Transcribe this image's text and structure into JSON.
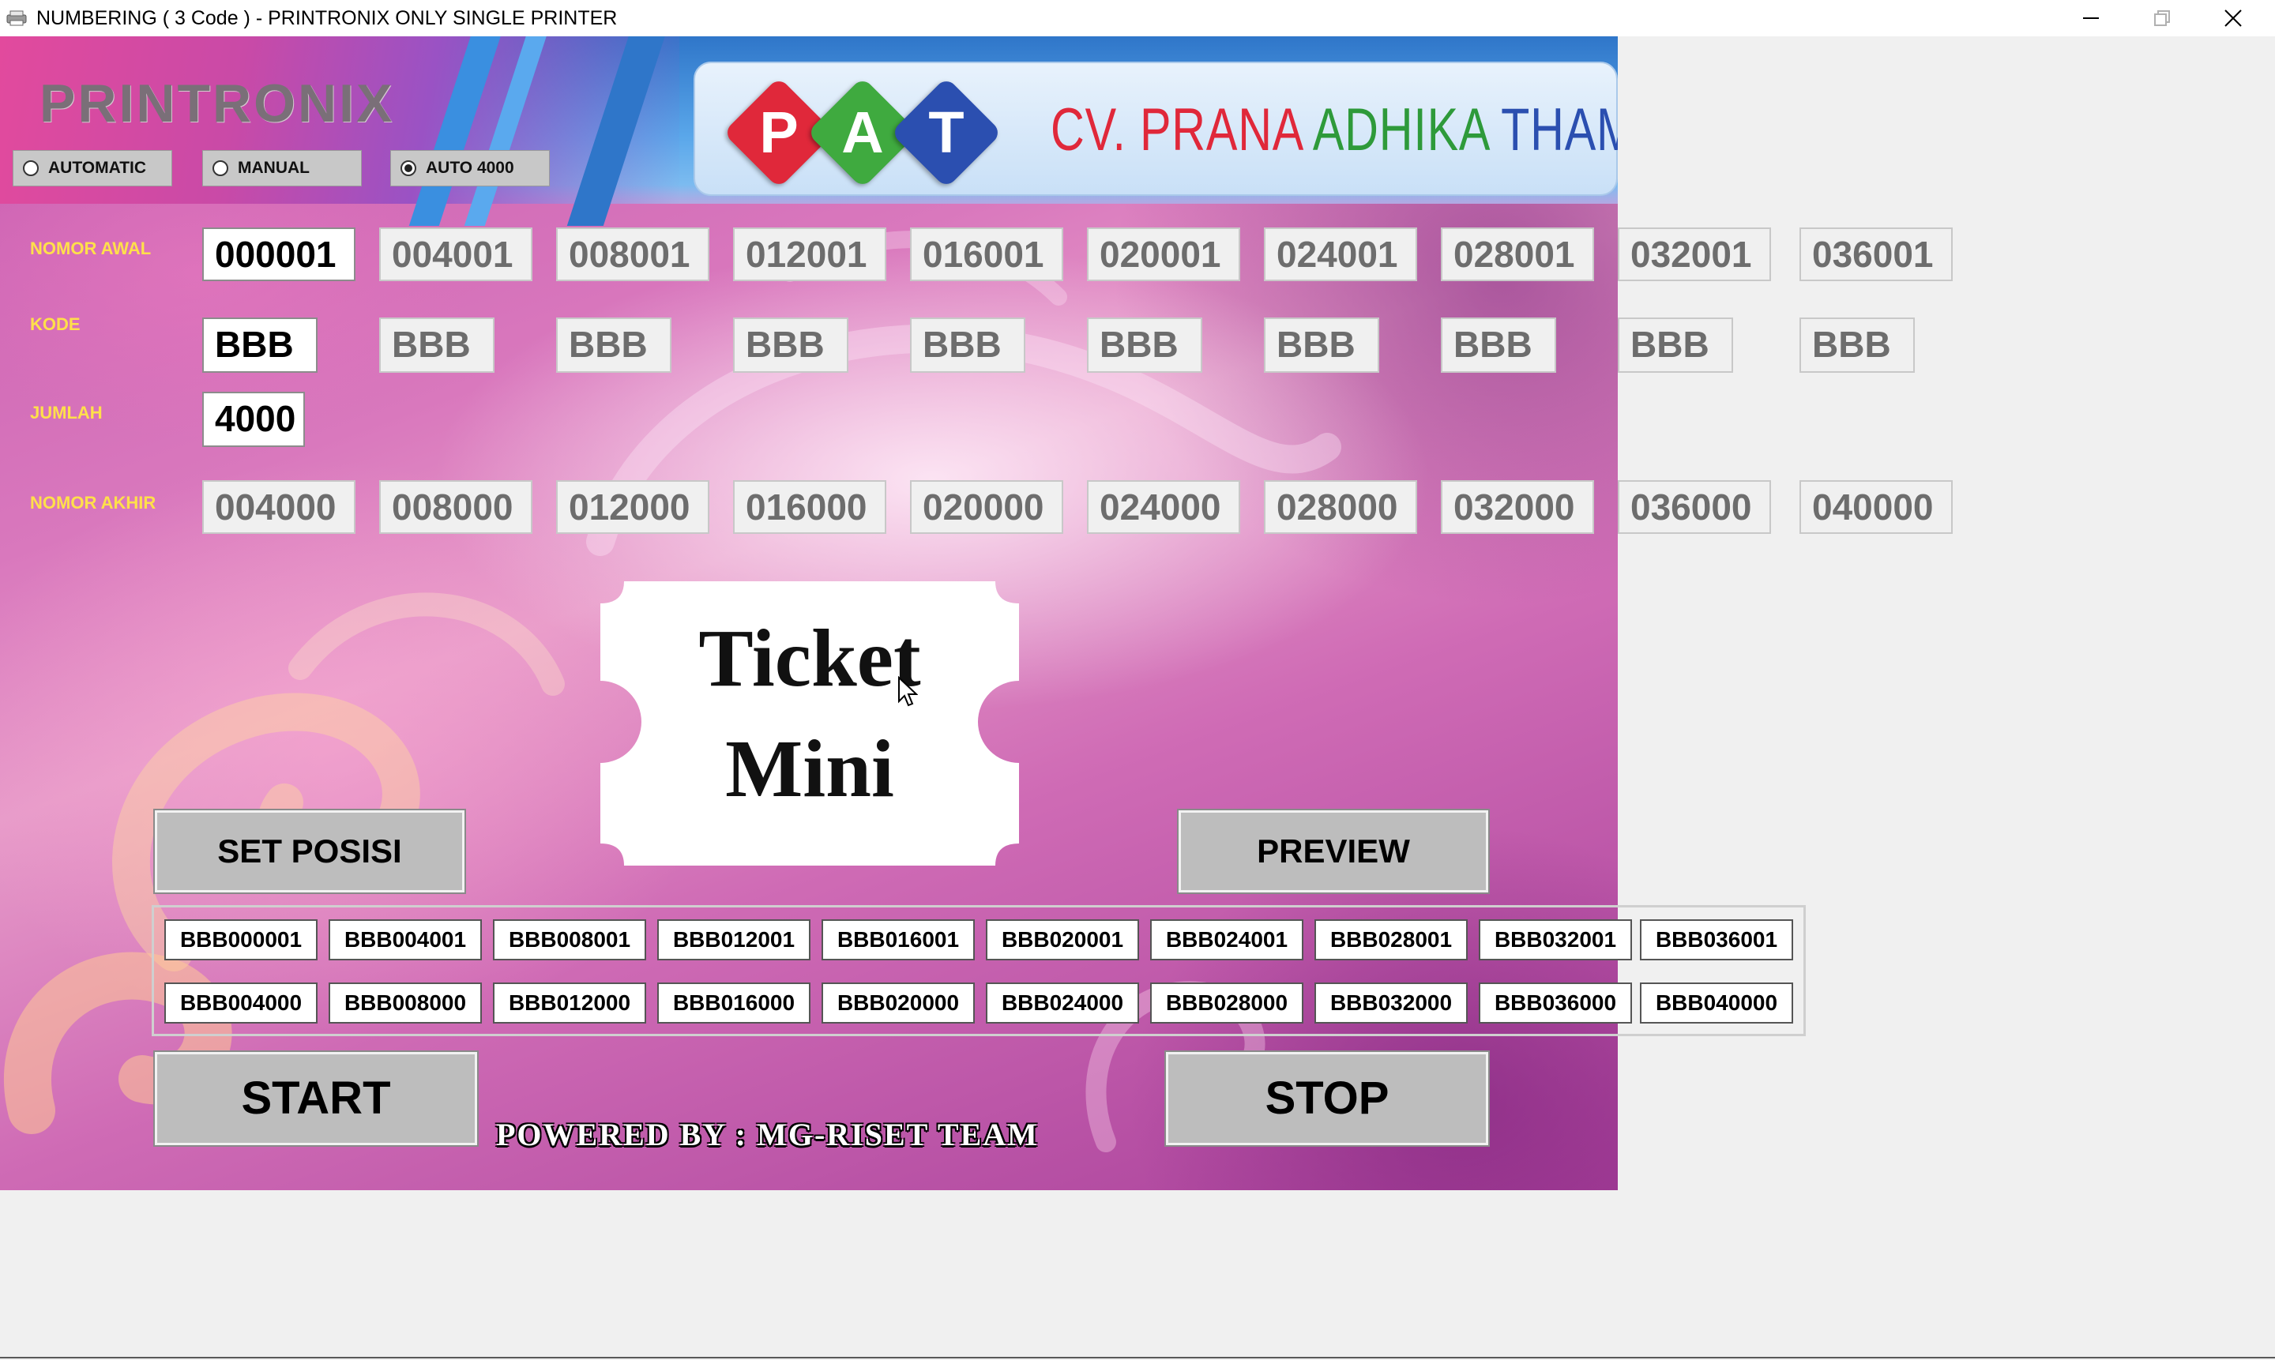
{
  "window": {
    "title": "NUMBERING ( 3 Code ) - PRINTRONIX ONLY SINGLE PRINTER"
  },
  "header": {
    "brand": "PRINTRONIX",
    "modes": [
      {
        "label": "AUTOMATIC",
        "selected": false
      },
      {
        "label": "MANUAL",
        "selected": false
      },
      {
        "label": "AUTO 4000",
        "selected": true
      }
    ],
    "logo": {
      "letters": [
        "P",
        "A",
        "T"
      ],
      "letter_colors": [
        "#e0283a",
        "#3faa3f",
        "#2b4fb0"
      ],
      "company_part1": "CV. PRANA ",
      "company_part2": "ADHIKA ",
      "company_part3": "THAMA"
    }
  },
  "labels": {
    "nomor_awal": "NOMOR AWAL",
    "kode": "KODE",
    "jumlah": "JUMLAH",
    "nomor_akhir": "NOMOR AKHIR"
  },
  "nomor_awal": [
    "000001",
    "004001",
    "008001",
    "012001",
    "016001",
    "020001",
    "024001",
    "028001",
    "032001",
    "036001"
  ],
  "kode": [
    "BBB",
    "BBB",
    "BBB",
    "BBB",
    "BBB",
    "BBB",
    "BBB",
    "BBB",
    "BBB",
    "BBB"
  ],
  "jumlah": "4000",
  "nomor_akhir": [
    "004000",
    "008000",
    "012000",
    "016000",
    "020000",
    "024000",
    "028000",
    "032000",
    "036000",
    "040000"
  ],
  "ticket": {
    "line1": "Ticket",
    "line2": "Mini"
  },
  "buttons": {
    "set_posisi": "SET POSISI",
    "preview": "PREVIEW",
    "start": "START",
    "stop": "STOP"
  },
  "codes_start": [
    "BBB000001",
    "BBB004001",
    "BBB008001",
    "BBB012001",
    "BBB016001",
    "BBB020001",
    "BBB024001",
    "BBB028001",
    "BBB032001",
    "BBB036001"
  ],
  "codes_end": [
    "BBB004000",
    "BBB008000",
    "BBB012000",
    "BBB016000",
    "BBB020000",
    "BBB024000",
    "BBB028000",
    "BBB032000",
    "BBB036000",
    "BBB040000"
  ],
  "footer": "POWERED BY : MG-RISET TEAM",
  "colors": {
    "label_yellow": "#ffe04a",
    "panel_pink": "#d978bd",
    "header_blue": "#2f76c9"
  }
}
